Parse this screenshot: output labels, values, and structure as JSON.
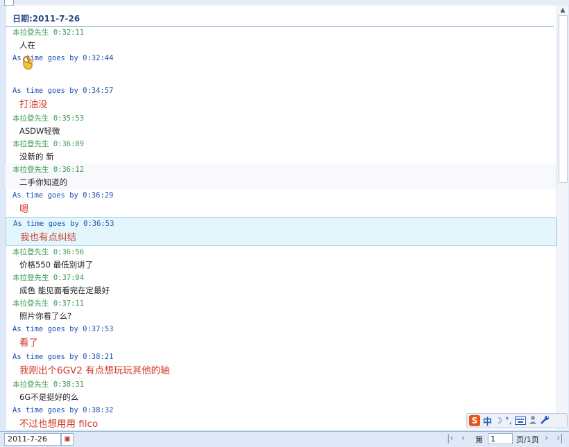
{
  "date_header": "日期:2011-7-26",
  "messages": [
    {
      "sender": "本拉登先生",
      "time": "0:32:11",
      "role": "self",
      "text": "人在",
      "size": "small"
    },
    {
      "sender": "As time goes by",
      "time": "0:32:44",
      "role": "other",
      "text": "",
      "size": "emoji",
      "emoji": "ok-hand-icon"
    },
    {
      "sender": "As time goes by",
      "time": "0:34:57",
      "role": "other",
      "text": "打油没",
      "size": "big"
    },
    {
      "sender": "本拉登先生",
      "time": "0:35:53",
      "role": "self",
      "text": "ASDW轻微",
      "size": "small"
    },
    {
      "sender": "本拉登先生",
      "time": "0:36:09",
      "role": "self",
      "text": "没新的 新",
      "size": "small"
    },
    {
      "sender": "本拉登先生",
      "time": "0:36:12",
      "role": "self",
      "text": "二手你知道的",
      "size": "small"
    },
    {
      "sender": "As time goes by",
      "time": "0:36:29",
      "role": "other",
      "text": "嗯",
      "size": "big"
    },
    {
      "sender": "As time goes by",
      "time": "0:36:53",
      "role": "other",
      "text": "我也有点纠结",
      "size": "big"
    },
    {
      "sender": "本拉登先生",
      "time": "0:36:56",
      "role": "self",
      "text": "价格550 最低别讲了",
      "size": "small"
    },
    {
      "sender": "本拉登先生",
      "time": "0:37:04",
      "role": "self",
      "text": "成色 能见面看完在定最好",
      "size": "small"
    },
    {
      "sender": "本拉登先生",
      "time": "0:37:11",
      "role": "self",
      "text": "照片你看了么?",
      "size": "small"
    },
    {
      "sender": "As time goes by",
      "time": "0:37:53",
      "role": "other",
      "text": "看了",
      "size": "big"
    },
    {
      "sender": "As time goes by",
      "time": "0:38:21",
      "role": "other",
      "text": "我刚出个6GV2 有点想玩玩其他的轴",
      "size": "big"
    },
    {
      "sender": "本拉登先生",
      "time": "0:38:31",
      "role": "self",
      "text": "6G不是挺好的么",
      "size": "small"
    },
    {
      "sender": "As time goes by",
      "time": "0:38:32",
      "role": "other",
      "text": "不过也想用用 filco",
      "size": "big"
    }
  ],
  "ime": {
    "logo": "S",
    "mode": "中",
    "moon": "☽",
    "punct": "°,"
  },
  "bottom": {
    "date_value": "2011-7-26",
    "page_prefix": "第",
    "page_value": "1",
    "page_suffix": "页/1页"
  },
  "colors": {
    "self": "#3a9a52",
    "other": "#1d4fb5",
    "big_text": "#d03a2a",
    "highlight": "#e3f6fc"
  }
}
